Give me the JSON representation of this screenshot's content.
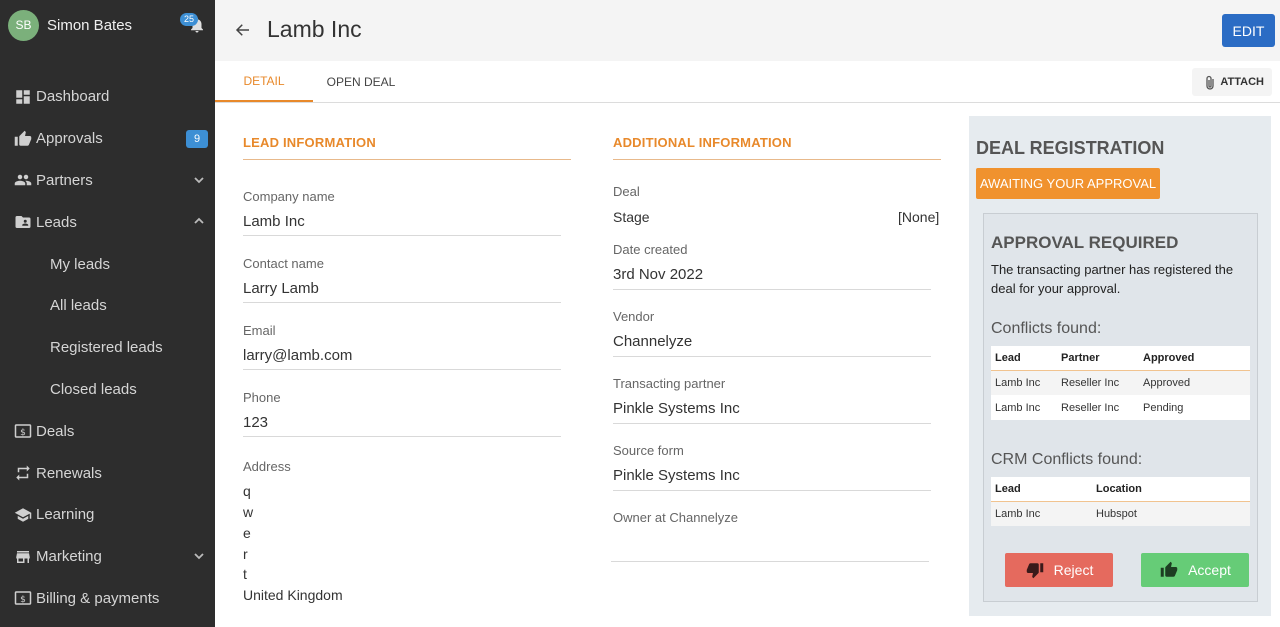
{
  "user": {
    "initials": "SB",
    "name": "Simon Bates",
    "notifications": "25"
  },
  "nav": {
    "dashboard": "Dashboard",
    "approvals": "Approvals",
    "approvals_count": "9",
    "partners": "Partners",
    "leads": "Leads",
    "my_leads": "My leads",
    "all_leads": "All leads",
    "registered_leads": "Registered leads",
    "closed_leads": "Closed leads",
    "deals": "Deals",
    "renewals": "Renewals",
    "learning": "Learning",
    "marketing": "Marketing",
    "billing": "Billing & payments"
  },
  "header": {
    "title": "Lamb Inc",
    "edit_label": "EDIT"
  },
  "tabs": {
    "detail": "DETAIL",
    "open_deal": "OPEN DEAL",
    "attach": "ATTACH"
  },
  "lead_info": {
    "heading": "LEAD INFORMATION",
    "company_label": "Company name",
    "company": "Lamb Inc",
    "contact_label": "Contact name",
    "contact": "Larry Lamb",
    "email_label": "Email",
    "email": "larry@lamb.com",
    "phone_label": "Phone",
    "phone": "123",
    "address_label": "Address",
    "address_lines": [
      "q",
      "w",
      "e",
      "r",
      "t",
      "United Kingdom"
    ]
  },
  "additional_info": {
    "heading": "ADDITIONAL INFORMATION",
    "deal_label": "Deal",
    "stage_label": "Stage",
    "stage_value": "[None]",
    "date_label": "Date created",
    "date": "3rd Nov 2022",
    "vendor_label": "Vendor",
    "vendor": "Channelyze",
    "partner_label": "Transacting partner",
    "partner": "Pinkle Systems Inc",
    "source_label": "Source form",
    "source": "Pinkle Systems Inc",
    "owner_label": "Owner at Channelyze",
    "owner": ""
  },
  "deal_reg": {
    "title": "DEAL REGISTRATION",
    "status": "AWAITING YOUR APPROVAL",
    "approval_title": "APPROVAL REQUIRED",
    "approval_desc": "The transacting partner has registered the deal for your approval.",
    "conflicts_title": "Conflicts found:",
    "conflicts_headers": [
      "Lead",
      "Partner",
      "Approved"
    ],
    "conflicts_rows": [
      [
        "Lamb Inc",
        "Reseller Inc",
        "Approved"
      ],
      [
        "Lamb Inc",
        "Reseller Inc",
        "Pending"
      ]
    ],
    "crm_title": "CRM Conflicts found:",
    "crm_headers": [
      "Lead",
      "Location"
    ],
    "crm_rows": [
      [
        "Lamb Inc",
        "Hubspot"
      ]
    ],
    "reject_label": "Reject",
    "accept_label": "Accept"
  },
  "colors": {
    "accent_orange": "#e8892b",
    "edit_blue": "#2b6cc4",
    "reject_red": "#e56a5e",
    "accept_green": "#66cc77",
    "sidebar_bg": "#2d2d2d"
  }
}
